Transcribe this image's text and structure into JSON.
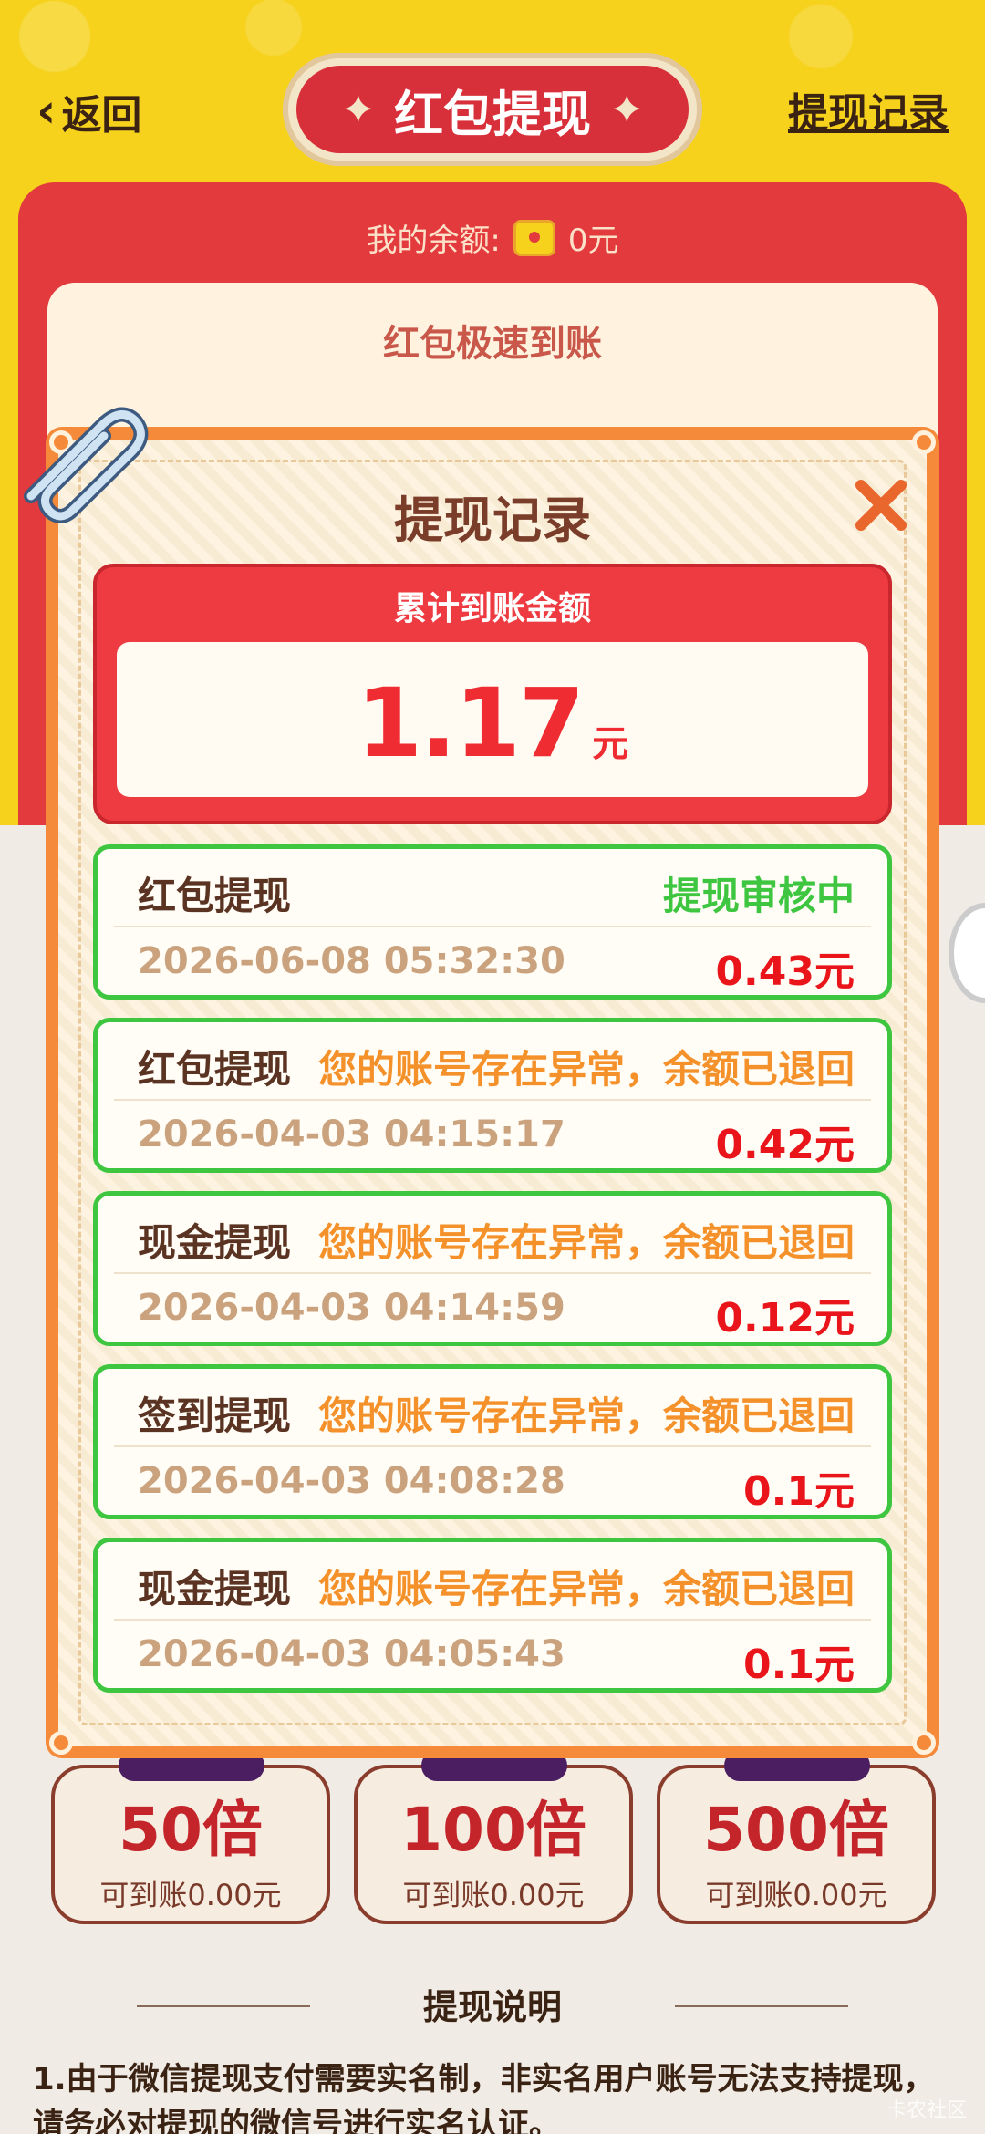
{
  "header": {
    "back_label": "返回",
    "title": "红包提现",
    "record_link": "提现记录"
  },
  "balance": {
    "label": "我的余额:",
    "value": "0元"
  },
  "speed_label": "红包极速到账",
  "multipliers": [
    {
      "value": "50倍",
      "sub": "可到账0.00元"
    },
    {
      "value": "100倍",
      "sub": "可到账0.00元"
    },
    {
      "value": "500倍",
      "sub": "可到账0.00元"
    }
  ],
  "explain": {
    "title": "提现说明",
    "text": "1.由于微信提现支付需要实名制，非实名用户账号无法支持提现，请务必对提现的微信号进行实名认证。"
  },
  "modal": {
    "title": "提现记录",
    "total_label": "累计到账金额",
    "total_amount": "1.17",
    "total_unit": "元",
    "records": [
      {
        "type": "红包提现",
        "status": "提现审核中",
        "status_color": "#3ec640",
        "time": "2026-06-08 05:32:30",
        "amount": "0.43元"
      },
      {
        "type": "红包提现",
        "status": "您的账号存在异常，余额已退回",
        "status_color": "#f5912a",
        "time": "2026-04-03 04:15:17",
        "amount": "0.42元"
      },
      {
        "type": "现金提现",
        "status": "您的账号存在异常，余额已退回",
        "status_color": "#f5912a",
        "time": "2026-04-03 04:14:59",
        "amount": "0.12元"
      },
      {
        "type": "签到提现",
        "status": "您的账号存在异常，余额已退回",
        "status_color": "#f5912a",
        "time": "2026-04-03 04:08:28",
        "amount": "0.1元"
      },
      {
        "type": "现金提现",
        "status": "您的账号存在异常，余额已退回",
        "status_color": "#f5912a",
        "time": "2026-04-03 04:05:43",
        "amount": "0.1元"
      }
    ]
  },
  "watermark": "卡农社区",
  "colors": {
    "brand_red": "#e23a3d",
    "success_green": "#3ec640",
    "warning_orange": "#f5912a",
    "amount_red": "#e9151a"
  }
}
